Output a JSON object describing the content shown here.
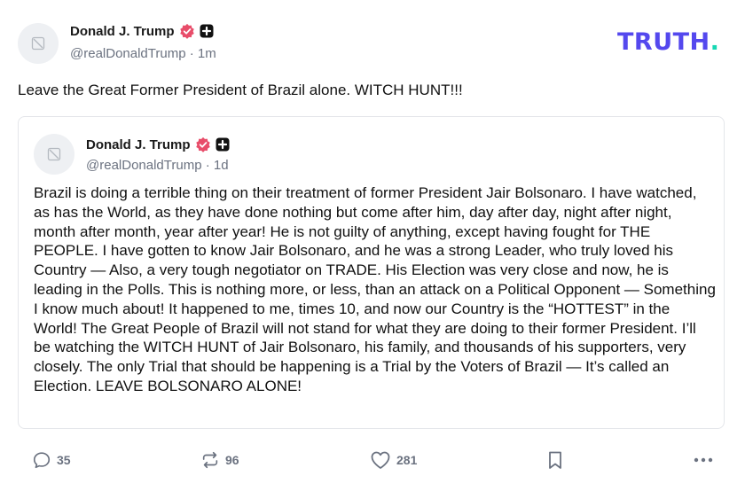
{
  "author": {
    "name": "Donald J. Trump",
    "handle": "@realDonaldTrump",
    "time": "1m"
  },
  "logo": {
    "text": "TRUTH",
    "dot": "."
  },
  "post": {
    "text": "Leave the Great Former President of Brazil alone. WITCH HUNT!!!"
  },
  "quoted": {
    "author": {
      "name": "Donald J. Trump",
      "handle": "@realDonaldTrump",
      "time": "1d"
    },
    "text": "Brazil is doing a terrible thing on their treatment of former President Jair Bolsonaro. I have watched, as has the World, as they have done nothing but come after him, day after day, night after night, month after month, year after year! He is not guilty of anything, except having fought for THE PEOPLE. I have gotten to know Jair Bolsonaro, and he was a strong Leader, who truly loved his Country — Also, a very tough negotiator on TRADE. His Election was very close and now, he is leading in the Polls. This is nothing more, or less, than an attack on a Political Opponent — Something I know much about! It happened to me, times 10, and now our Country is the “HOTTEST” in the World! The Great People of Brazil will not stand for what they are doing to their former President. I’ll be watching the WITCH HUNT of Jair Bolsonaro, his family, and thousands of his supporters, very closely. The only Trial that should be happening is a Trial by the Voters of Brazil — It’s called an Election. LEAVE BOLSONARO ALONE!"
  },
  "actions": {
    "replies": "35",
    "retruths": "96",
    "likes": "281"
  },
  "colors": {
    "brand": "#5448ee",
    "brand_dot": "#17d8b3",
    "verified": "#e84d6a"
  },
  "icons": [
    "avatar-placeholder-icon",
    "verified-badge-icon",
    "plus-badge-icon",
    "reply-icon",
    "retruth-icon",
    "like-icon",
    "bookmark-icon",
    "more-icon"
  ]
}
